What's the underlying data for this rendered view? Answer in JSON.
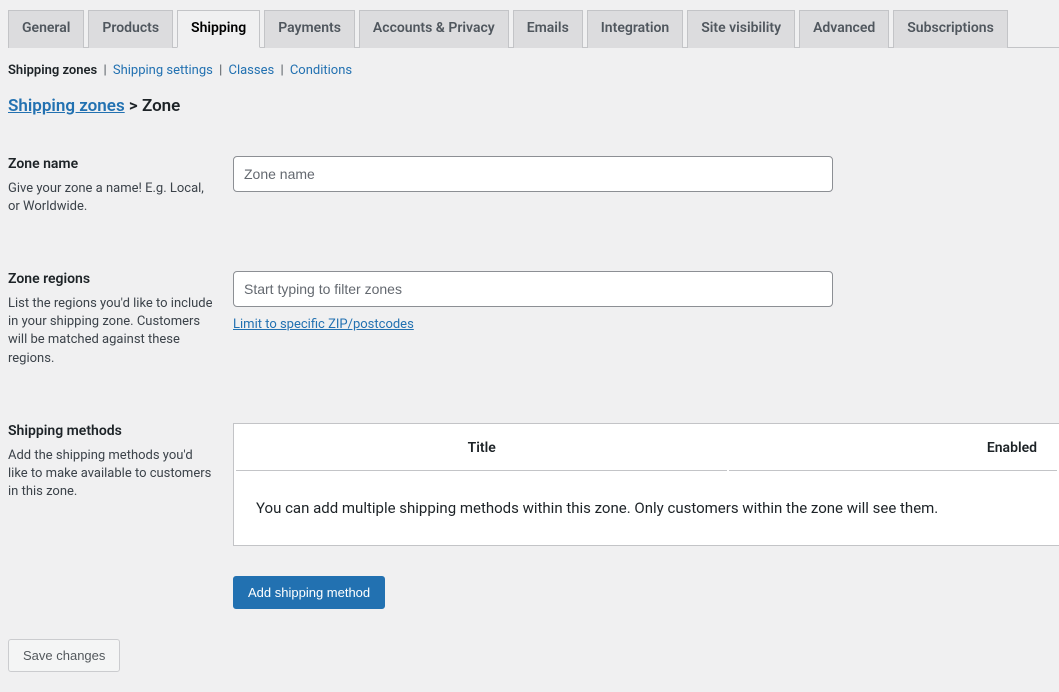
{
  "tabs": [
    {
      "label": "General",
      "active": false
    },
    {
      "label": "Products",
      "active": false
    },
    {
      "label": "Shipping",
      "active": true
    },
    {
      "label": "Payments",
      "active": false
    },
    {
      "label": "Accounts & Privacy",
      "active": false
    },
    {
      "label": "Emails",
      "active": false
    },
    {
      "label": "Integration",
      "active": false
    },
    {
      "label": "Site visibility",
      "active": false
    },
    {
      "label": "Advanced",
      "active": false
    },
    {
      "label": "Subscriptions",
      "active": false
    }
  ],
  "subtabs": [
    {
      "label": "Shipping zones",
      "current": true
    },
    {
      "label": "Shipping settings",
      "current": false
    },
    {
      "label": "Classes",
      "current": false
    },
    {
      "label": "Conditions",
      "current": false
    }
  ],
  "breadcrumb": {
    "root": "Shipping zones",
    "sep": " > ",
    "current": "Zone"
  },
  "form": {
    "zone_name": {
      "label": "Zone name",
      "desc": "Give your zone a name! E.g. Local, or Worldwide.",
      "placeholder": "Zone name",
      "value": ""
    },
    "zone_regions": {
      "label": "Zone regions",
      "desc": "List the regions you'd like to include in your shipping zone. Customers will be matched against these regions.",
      "placeholder": "Start typing to filter zones",
      "value": "",
      "link": "Limit to specific ZIP/postcodes"
    },
    "shipping_methods": {
      "label": "Shipping methods",
      "desc": "Add the shipping methods you'd like to make available to customers in this zone.",
      "columns": {
        "title": "Title",
        "enabled": "Enabled"
      },
      "empty_text": "You can add multiple shipping methods within this zone. Only customers within the zone will see them."
    }
  },
  "buttons": {
    "add_method": "Add shipping method",
    "save": "Save changes"
  }
}
